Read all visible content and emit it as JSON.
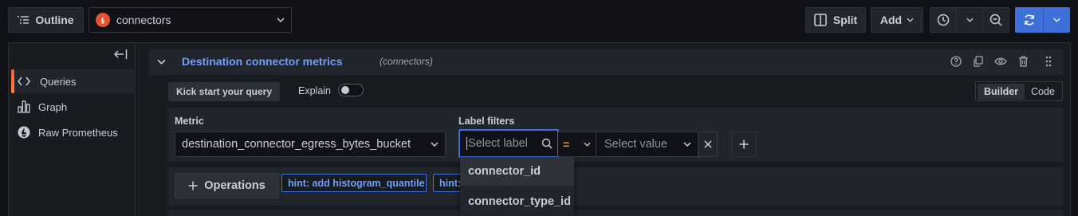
{
  "toolbar": {
    "outline_label": "Outline",
    "datasource_name": "connectors",
    "split_label": "Split",
    "add_label": "Add"
  },
  "sidebar": {
    "items": [
      {
        "label": "Queries",
        "icon": "code-icon",
        "active": true
      },
      {
        "label": "Graph",
        "icon": "bar-chart-icon",
        "active": false
      },
      {
        "label": "Raw Prometheus",
        "icon": "prometheus-icon",
        "active": false
      }
    ]
  },
  "query": {
    "title": "Destination connector metrics",
    "datasource_hint": "(connectors)",
    "kick_start_label": "Kick start your query",
    "explain_label": "Explain",
    "explain_on": false,
    "mode_builder": "Builder",
    "mode_code": "Code",
    "metric_label": "Metric",
    "metric_value": "destination_connector_egress_bytes_bucket",
    "label_filters_label": "Label filters",
    "label_placeholder": "Select label",
    "operator": "=",
    "value_placeholder": "Select value",
    "operations_label": "Operations",
    "hints": [
      "hint: add histogram_quantile",
      "hint:"
    ]
  },
  "dropdown": {
    "options": [
      "connector_id",
      "connector_type_id"
    ]
  },
  "colors": {
    "accent": "#3d71d9",
    "title_blue": "#6e9fff",
    "operator_orange": "#ff9900",
    "prometheus": "#e6522c"
  }
}
